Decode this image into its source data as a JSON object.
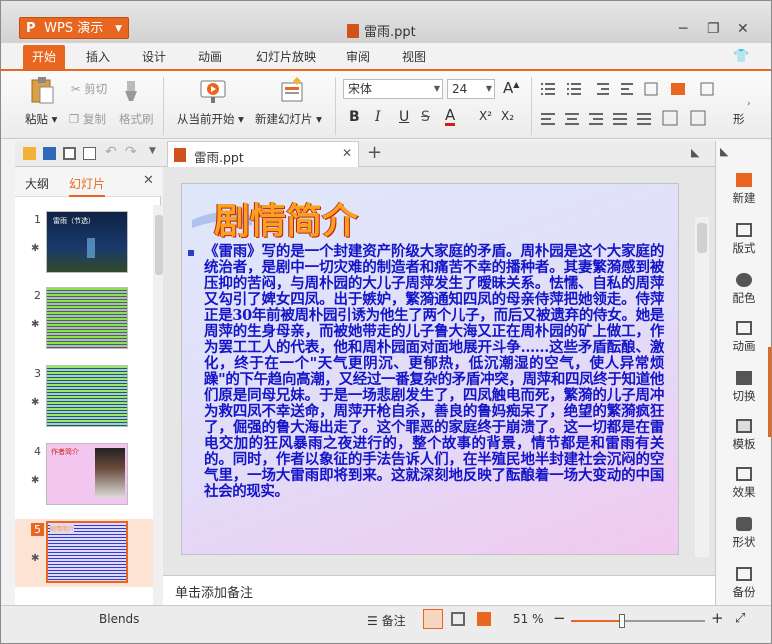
{
  "app": {
    "name": "WPS 演示",
    "logo_letter": "P",
    "document_title": "雷雨.ppt"
  },
  "menu_tabs": [
    "开始",
    "插入",
    "设计",
    "动画",
    "幻灯片放映",
    "审阅",
    "视图"
  ],
  "ribbon": {
    "paste": "粘贴",
    "cut": "剪切",
    "copy": "复制",
    "format_painter": "格式刷",
    "from_current": "从当前开始",
    "new_slide": "新建幻灯片",
    "font_name": "宋体",
    "font_size": "24",
    "bold": "B",
    "italic": "I",
    "underline": "U",
    "font_color": "A",
    "superscript": "X²",
    "subscript": "X₂",
    "shadow": "S",
    "grow_font": "A",
    "shrink_font": "A",
    "more_label": "形"
  },
  "doc_tab": {
    "title": "雷雨.ppt",
    "new_tab": "+"
  },
  "left_panel": {
    "tabs": [
      "大纲",
      "幻灯片"
    ],
    "thumbnails": [
      {
        "num": "1",
        "caption": "雷雨（节选）"
      },
      {
        "num": "2"
      },
      {
        "num": "3"
      },
      {
        "num": "4",
        "caption": "作者简介"
      },
      {
        "num": "5",
        "caption": "剧情简介"
      }
    ]
  },
  "slide": {
    "title": "剧情简介",
    "body": "《雷雨》写的是一个封建资产阶级大家庭的矛盾。周朴园是这个大家庭的统治者，是剧中一切灾难的制造者和痛苦不幸的播种者。其妻繁漪感到被压抑的苦闷，与周朴园的大儿子周萍发生了暧昧关系。怯懦、自私的周萍又勾引了婢女四凤。出于嫉妒，繁漪通知四凤的母亲侍萍把她领走。侍萍正是30年前被周朴园引诱为他生了两个儿子，而后又被遗弃的侍女。她是周萍的生身母亲，而被她带走的儿子鲁大海又正在周朴园的矿上做工，作为罢工工人的代表，他和周朴园面对面地展开斗争……这些矛盾酝酿、激化，终于在一个\"天气更阴沉、更郁热，低沉潮湿的空气，使人异常烦躁\"的下午趋向高潮，又经过一番复杂的矛盾冲突，周萍和四凤终于知道他们原是同母兄妹。于是一场悲剧发生了，四凤触电而死，繁漪的儿子周冲为救四凤不幸送命，周萍开枪自杀，善良的鲁妈痴呆了，绝望的繁漪疯狂了，倔强的鲁大海出走了。这个罪恶的家庭终于崩溃了。这一切都是在雷电交加的狂风暴雨之夜进行的，整个故事的背景，情节都是和雷雨有关的。同时，作者以象征的手法告诉人们，在半殖民地半封建社会沉闷的空气里，一场大雷雨即将到来。这就深刻地反映了酝酿着一场大变动的中国社会的现实。"
  },
  "notes_placeholder": "单击添加备注",
  "right_panel": [
    "新建",
    "版式",
    "配色",
    "动画",
    "切换",
    "模板",
    "效果",
    "形状",
    "备份"
  ],
  "status": {
    "theme": "Blends",
    "notes_btn": "备注",
    "zoom": "51 %",
    "zoom_level": 0.38
  },
  "colors": {
    "accent": "#e8661f",
    "title": "#f8a020",
    "body_text": "#1414c8"
  }
}
